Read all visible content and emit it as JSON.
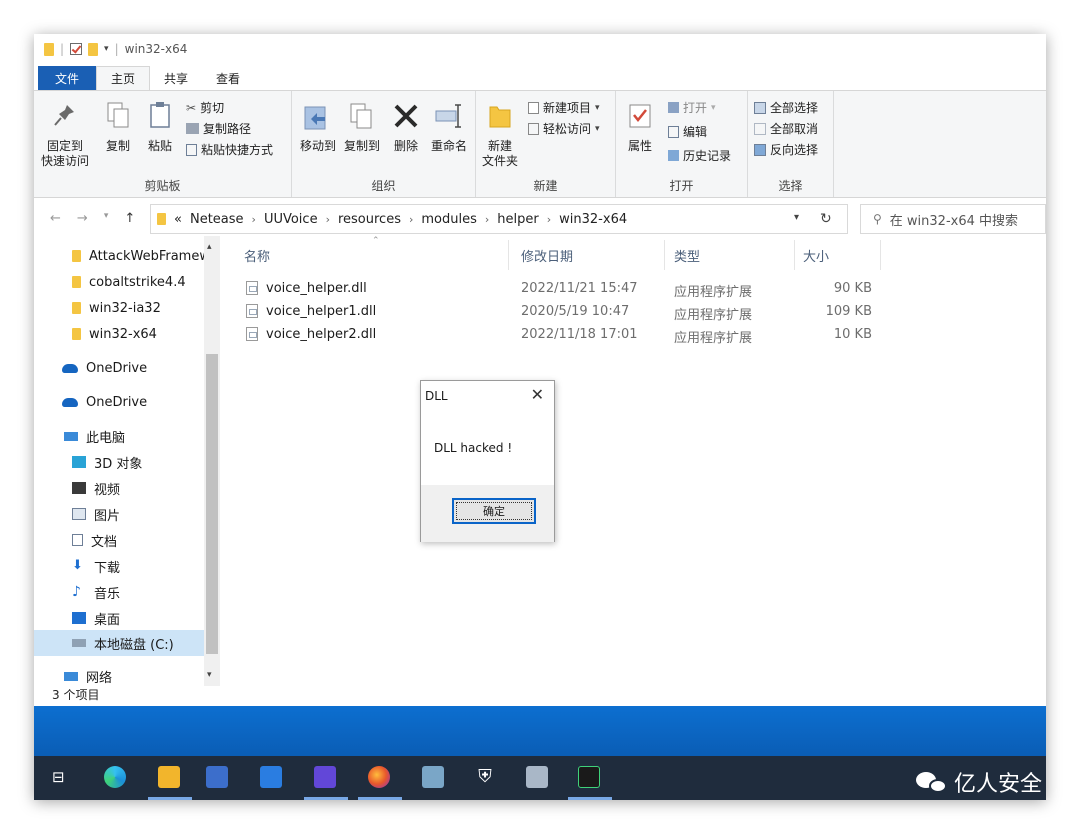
{
  "window": {
    "title": "win32-x64",
    "quick_access_dropdown": "▾"
  },
  "ribbon_tabs": [
    "文件",
    "主页",
    "共享",
    "查看"
  ],
  "ribbon": {
    "clipboard": {
      "label": "剪贴板",
      "pin_line1": "固定到",
      "pin_line2": "快速访问",
      "copy": "复制",
      "paste": "粘贴",
      "cut": "剪切",
      "copy_path": "复制路径",
      "paste_shortcut": "粘贴快捷方式"
    },
    "organize": {
      "label": "组织",
      "move_to": "移动到",
      "copy_to": "复制到",
      "delete": "删除",
      "rename": "重命名"
    },
    "new": {
      "label": "新建",
      "new_folder_line1": "新建",
      "new_folder_line2": "文件夹",
      "new_item": "新建项目",
      "easy_access": "轻松访问"
    },
    "open": {
      "label": "打开",
      "properties": "属性",
      "open": "打开",
      "edit": "编辑",
      "history": "历史记录"
    },
    "select": {
      "label": "选择",
      "select_all": "全部选择",
      "select_none": "全部取消",
      "invert": "反向选择"
    }
  },
  "address": {
    "prefix": "«",
    "segments": [
      "Netease",
      "UUVoice",
      "resources",
      "modules",
      "helper",
      "win32-x64"
    ],
    "search_placeholder": "在 win32-x64 中搜索"
  },
  "nav_pane": {
    "items": [
      {
        "label": "AttackWebFramew",
        "icon": "folder-icon"
      },
      {
        "label": "cobaltstrike4.4",
        "icon": "folder-icon"
      },
      {
        "label": "win32-ia32",
        "icon": "folder-icon"
      },
      {
        "label": "win32-x64",
        "icon": "folder-icon"
      },
      {
        "label": "OneDrive",
        "icon": "cloud-icon"
      },
      {
        "label": "OneDrive",
        "icon": "cloud-icon"
      },
      {
        "label": "此电脑",
        "icon": "computer-icon"
      },
      {
        "label": "3D 对象",
        "icon": "3d-objects-icon"
      },
      {
        "label": "视频",
        "icon": "video-icon"
      },
      {
        "label": "图片",
        "icon": "pictures-icon"
      },
      {
        "label": "文档",
        "icon": "documents-icon"
      },
      {
        "label": "下载",
        "icon": "download-icon"
      },
      {
        "label": "音乐",
        "icon": "music-icon"
      },
      {
        "label": "桌面",
        "icon": "desktop-icon"
      },
      {
        "label": "本地磁盘 (C:)",
        "icon": "drive-icon"
      },
      {
        "label": "网络",
        "icon": "network-icon"
      }
    ],
    "selected": "本地磁盘 (C:)"
  },
  "file_list": {
    "columns": [
      "名称",
      "修改日期",
      "类型",
      "大小"
    ],
    "rows": [
      {
        "name": "voice_helper.dll",
        "date": "2022/11/21 15:47",
        "type": "应用程序扩展",
        "size": "90 KB"
      },
      {
        "name": "voice_helper1.dll",
        "date": "2020/5/19 10:47",
        "type": "应用程序扩展",
        "size": "109 KB"
      },
      {
        "name": "voice_helper2.dll",
        "date": "2022/11/18 17:01",
        "type": "应用程序扩展",
        "size": "10 KB"
      }
    ]
  },
  "status_bar": "3 个项目",
  "dialog": {
    "title": "DLL",
    "message": "DLL hacked !",
    "ok_label": "确定",
    "close_glyph": "✕"
  },
  "taskbar": {
    "watermark": "亿人安全"
  },
  "colors": {
    "file_tab": "#1a5fb4",
    "taskbar": "#1f2c3d",
    "desktop": "#0d6fd0",
    "selection": "#cde4f7",
    "folder": "#f4c542"
  }
}
